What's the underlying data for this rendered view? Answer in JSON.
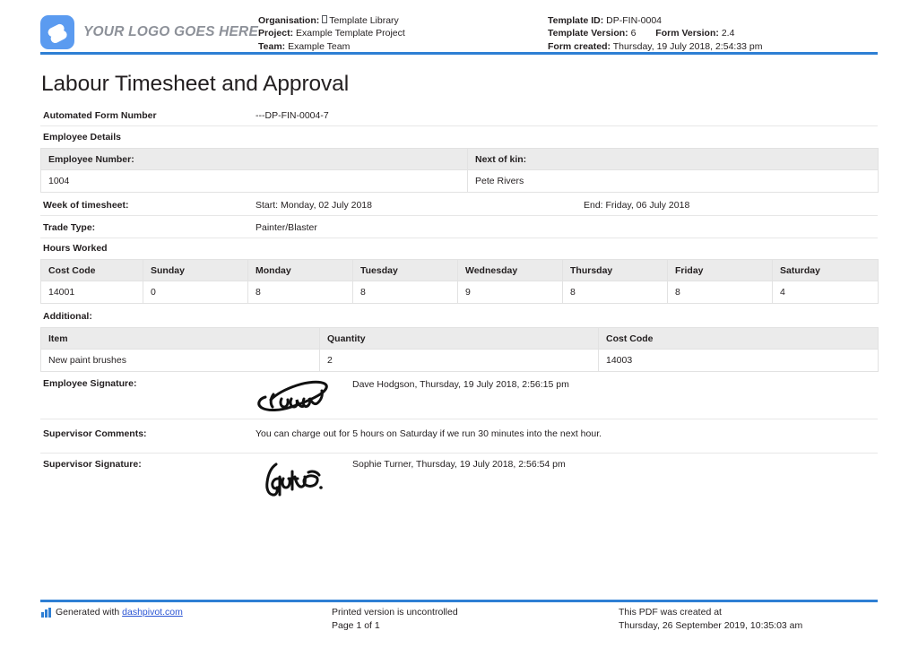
{
  "header": {
    "logo_text": "YOUR LOGO GOES HERE",
    "organisation_label": "Organisation:",
    "organisation_value": "Template Library",
    "project_label": "Project:",
    "project_value": "Example Template Project",
    "team_label": "Team:",
    "team_value": "Example Team",
    "template_id_label": "Template ID:",
    "template_id_value": "DP-FIN-0004",
    "template_version_label": "Template Version:",
    "template_version_value": "6",
    "form_version_label": "Form Version:",
    "form_version_value": "2.4",
    "form_created_label": "Form created:",
    "form_created_value": "Thursday, 19 July 2018, 2:54:33 pm"
  },
  "document": {
    "title": "Labour Timesheet and Approval",
    "automated_form_number_label": "Automated Form Number",
    "automated_form_number_value": "---DP-FIN-0004-7",
    "employee_details_heading": "Employee Details",
    "employee_table": {
      "headers": [
        "Employee Number:",
        "Next of kin:"
      ],
      "row": [
        "1004",
        "Pete Rivers"
      ]
    },
    "week_label": "Week of timesheet:",
    "week_start": "Start: Monday, 02 July 2018",
    "week_end": "End: Friday, 06 July 2018",
    "trade_type_label": "Trade Type:",
    "trade_type_value": "Painter/Blaster",
    "hours_worked_heading": "Hours Worked",
    "hours_table": {
      "headers": [
        "Cost Code",
        "Sunday",
        "Monday",
        "Tuesday",
        "Wednesday",
        "Thursday",
        "Friday",
        "Saturday"
      ],
      "row": [
        "14001",
        "0",
        "8",
        "8",
        "9",
        "8",
        "8",
        "4"
      ]
    },
    "additional_heading": "Additional:",
    "additional_table": {
      "headers": [
        "Item",
        "Quantity",
        "Cost Code"
      ],
      "row": [
        "New paint brushes",
        "2",
        "14003"
      ]
    },
    "employee_signature_label": "Employee Signature:",
    "employee_signature_caption": "Dave Hodgson, Thursday, 19 July 2018, 2:56:15 pm",
    "supervisor_comments_label": "Supervisor Comments:",
    "supervisor_comments_value": "You can charge out for 5 hours on Saturday if we run 30 minutes into the next hour.",
    "supervisor_signature_label": "Supervisor Signature:",
    "supervisor_signature_caption": "Sophie Turner, Thursday, 19 July 2018, 2:56:54 pm"
  },
  "footer": {
    "generated_with": "Generated with",
    "generated_link": "dashpivot.com",
    "printed_notice": "Printed version is uncontrolled",
    "page_number": "Page 1 of 1",
    "pdf_created_label": "This PDF was created at",
    "pdf_created_value": "Thursday, 26 September 2019, 10:35:03 am"
  },
  "colors": {
    "accent_blue": "#2e7fd4",
    "logo_blue": "#5b9bf0",
    "link_blue": "#2b55d4",
    "table_header_grey": "#ebebeb",
    "rule_grey": "#e7e7e7"
  }
}
